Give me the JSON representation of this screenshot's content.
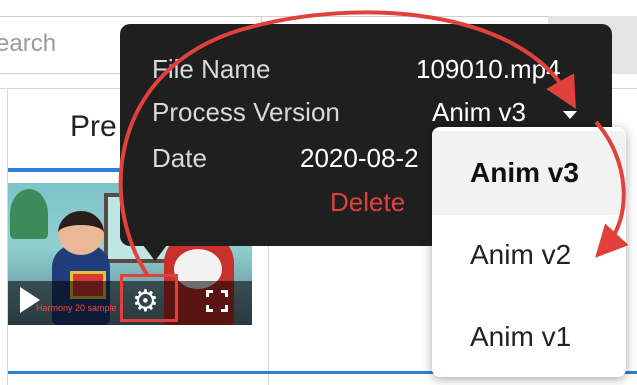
{
  "search": {
    "text": "earch"
  },
  "table": {
    "preview_header": "Pre"
  },
  "video": {
    "watermark": "Harmony 20 sample"
  },
  "popup": {
    "file_name_label": "File Name",
    "file_name_value": "109010.mp4",
    "process_version_label": "Process Version",
    "process_version_value": "Anim v3",
    "date_label": "Date",
    "date_value": "2020-08-2",
    "delete_label": "Delete"
  },
  "dropdown": {
    "options": [
      "Anim v3",
      "Anim v2",
      "Anim v1"
    ],
    "selected": "Anim v3"
  },
  "colors": {
    "annotation_red": "#e0413a",
    "accent_blue": "#2f7fd6",
    "popup_bg": "#1f1f1f",
    "delete_red": "#e1413b"
  },
  "icons": [
    "play-icon",
    "gear-icon",
    "fullscreen-icon",
    "caret-down-icon"
  ]
}
